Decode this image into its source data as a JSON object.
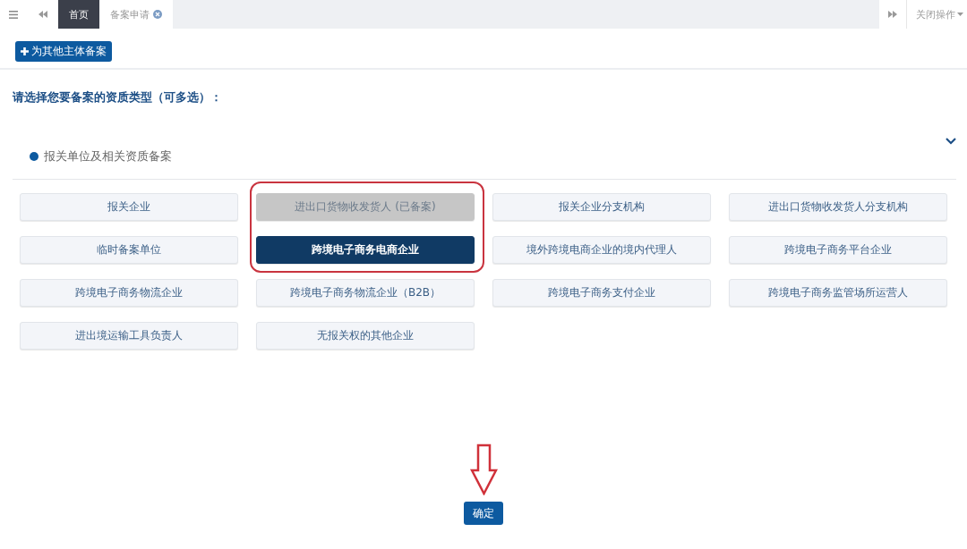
{
  "tabs": [
    {
      "label": "首页",
      "selected": true
    },
    {
      "label": "备案申请",
      "selected": false,
      "closable": true
    }
  ],
  "close_menu": {
    "label": "关闭操作"
  },
  "add_button": {
    "label": "为其他主体备案"
  },
  "prompt": "请选择您要备案的资质类型（可多选）：",
  "section": {
    "title": "报关单位及相关资质备案",
    "expanded": true
  },
  "options": [
    {
      "label": "报关企业",
      "selected": false,
      "disabled": false
    },
    {
      "label": "进出口货物收发货人 (已备案)",
      "selected": false,
      "disabled": true
    },
    {
      "label": "报关企业分支机构",
      "selected": false,
      "disabled": false
    },
    {
      "label": "进出口货物收发货人分支机构",
      "selected": false,
      "disabled": false
    },
    {
      "label": "临时备案单位",
      "selected": false,
      "disabled": false
    },
    {
      "label": "跨境电子商务电商企业",
      "selected": true,
      "disabled": false
    },
    {
      "label": "境外跨境电商企业的境内代理人",
      "selected": false,
      "disabled": false
    },
    {
      "label": "跨境电子商务平台企业",
      "selected": false,
      "disabled": false
    },
    {
      "label": "跨境电子商务物流企业",
      "selected": false,
      "disabled": false
    },
    {
      "label": "跨境电子商务物流企业（B2B）",
      "selected": false,
      "disabled": false
    },
    {
      "label": "跨境电子商务支付企业",
      "selected": false,
      "disabled": false
    },
    {
      "label": "跨境电子商务监管场所运营人",
      "selected": false,
      "disabled": false
    },
    {
      "label": "进出境运输工具负责人",
      "selected": false,
      "disabled": false
    },
    {
      "label": "无报关权的其他企业",
      "selected": false,
      "disabled": false
    }
  ],
  "confirm_button": {
    "label": "确定"
  }
}
